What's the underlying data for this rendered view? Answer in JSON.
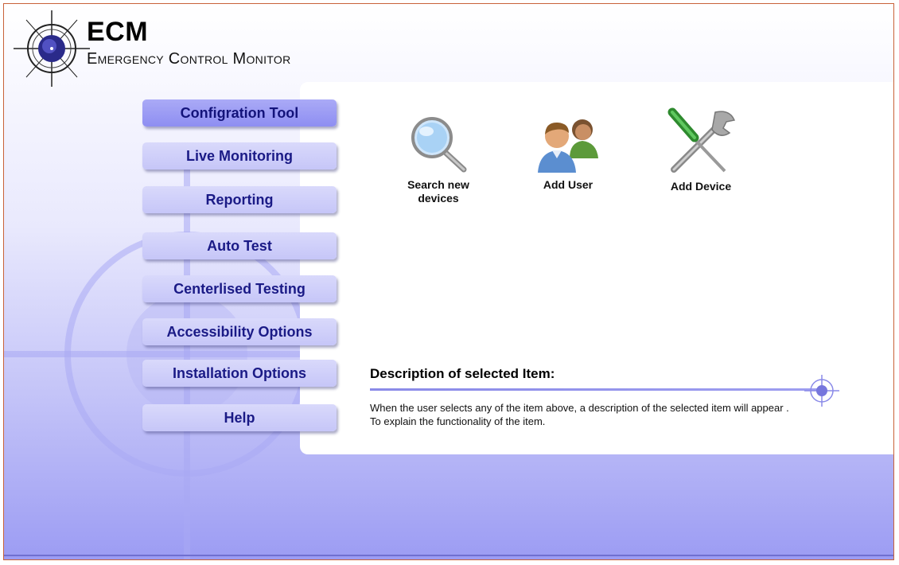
{
  "brand": {
    "title": "ECM",
    "subtitle": "Emergency Control Monitor"
  },
  "nav": {
    "items": [
      {
        "label": "Configration Tool",
        "active": true
      },
      {
        "label": "Live Monitoring",
        "active": false
      },
      {
        "label": "Reporting",
        "active": false
      },
      {
        "label": "Auto Test",
        "active": false
      },
      {
        "label": "Centerlised Testing",
        "active": false
      },
      {
        "label": "Accessibility Options",
        "active": false
      },
      {
        "label": "Installation Options",
        "active": false
      },
      {
        "label": "Help",
        "active": false
      }
    ]
  },
  "tools": {
    "search": {
      "label_line1": "Search new",
      "label_line2": "devices",
      "icon": "magnifier-icon"
    },
    "add_user": {
      "label": "Add User",
      "icon": "users-icon"
    },
    "add_device": {
      "label": "Add Device",
      "icon": "screwdriver-wrench-icon"
    }
  },
  "description": {
    "title": "Description of selected Item:",
    "line1": "When the user selects any of the item above, a description of the selected item will appear .",
    "line2": "To explain the functionality of the item."
  },
  "colors": {
    "accent": "#8e8ef2",
    "nav_text": "#1a1a86",
    "frame_border": "#c8623a"
  }
}
